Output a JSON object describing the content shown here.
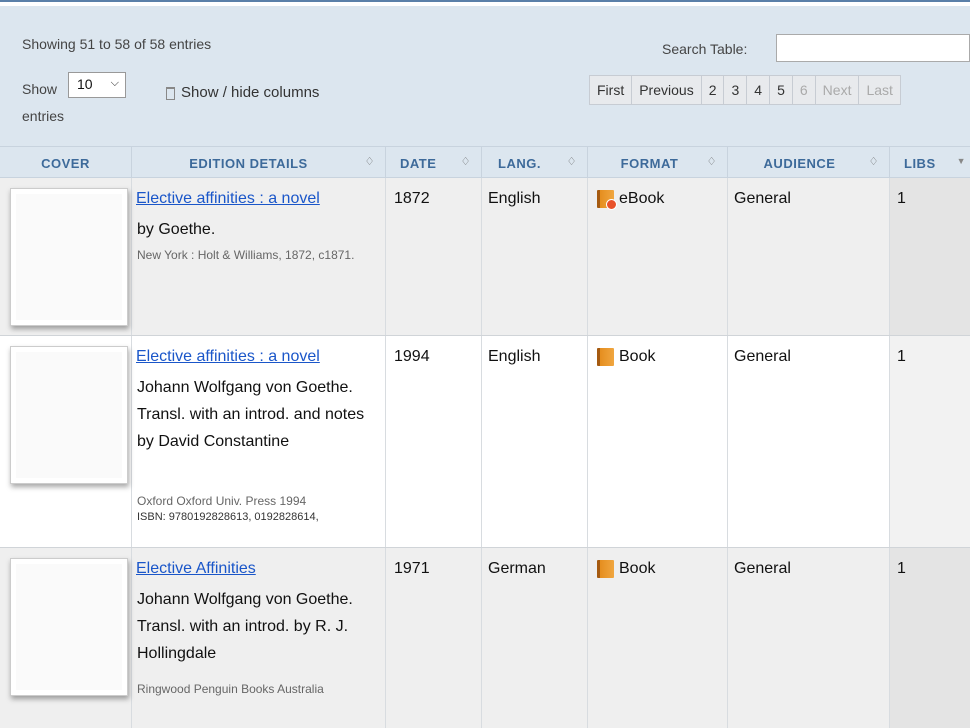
{
  "toolbar": {
    "showing": "Showing 51 to 58 of 58 entries",
    "show_label": "Show",
    "page_size": "10",
    "entries_label": "entries",
    "columns_button": "Show / hide columns",
    "search_label": "Search Table:",
    "search_value": ""
  },
  "pager": {
    "first": "First",
    "previous": "Previous",
    "pages": [
      "2",
      "3",
      "4",
      "5",
      "6"
    ],
    "current_page": "6",
    "next": "Next",
    "last": "Last"
  },
  "columns": {
    "cover": "COVER",
    "edition": "EDITION DETAILS",
    "date": "DATE",
    "lang": "LANG.",
    "format": "FORMAT",
    "audience": "AUDIENCE",
    "libs": "LIBS"
  },
  "rows": [
    {
      "title": "Elective affinities : a novel",
      "author": "by Goethe.",
      "publisher": "New York : Holt & Williams, 1872, c1871.",
      "isbn": "",
      "date": "1872",
      "lang": "English",
      "format": "eBook",
      "format_icon": "ebook-icon",
      "audience": "General",
      "libs": "1"
    },
    {
      "title": "Elective affinities : a novel",
      "author": "Johann Wolfgang von Goethe. Transl. with an introd. and notes by David Constantine",
      "publisher": "Oxford Oxford Univ. Press 1994",
      "isbn": "ISBN: 9780192828613, 0192828614,",
      "date": "1994",
      "lang": "English",
      "format": "Book",
      "format_icon": "book-icon",
      "audience": "General",
      "libs": "1"
    },
    {
      "title": "Elective Affinities",
      "author": "Johann Wolfgang von Goethe. Transl. with an introd. by R. J. Hollingdale",
      "publisher": "Ringwood Penguin Books Australia",
      "isbn": "",
      "date": "1971",
      "lang": "German",
      "format": "Book",
      "format_icon": "book-icon",
      "audience": "General",
      "libs": "1"
    }
  ],
  "colors": {
    "header_bg": "#dce6ef",
    "header_text": "#3d6a9a",
    "link": "#1a56c9",
    "row_shaded": "#efefef",
    "libs_col": "#e4e4e4"
  }
}
